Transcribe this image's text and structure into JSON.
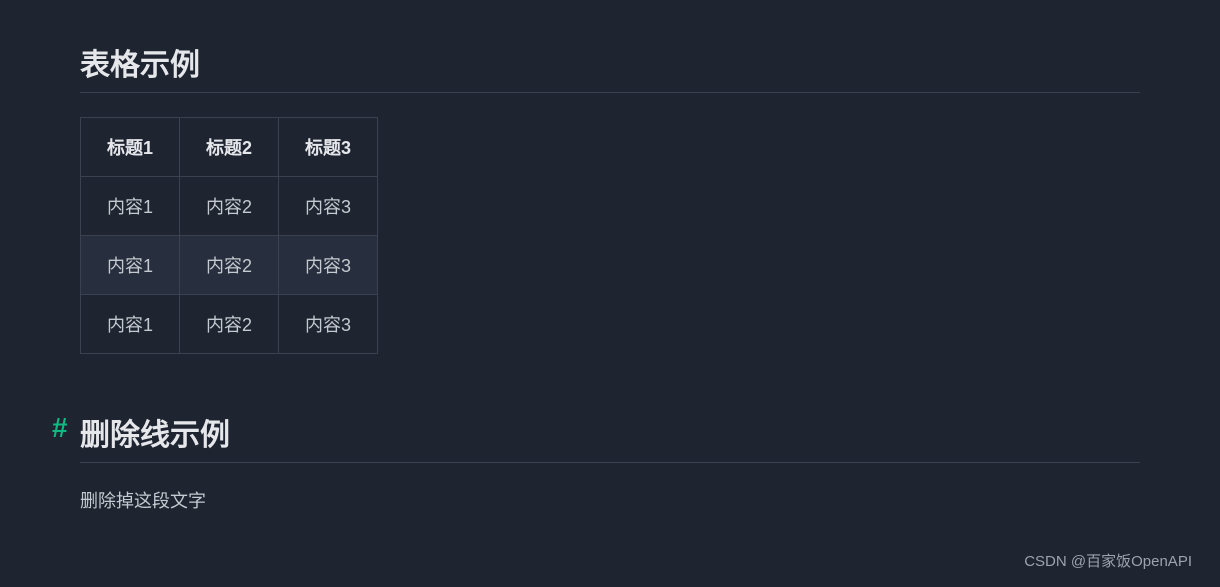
{
  "section_table": {
    "title": "表格示例",
    "headers": [
      "标题1",
      "标题2",
      "标题3"
    ],
    "rows": [
      [
        "内容1",
        "内容2",
        "内容3"
      ],
      [
        "内容1",
        "内容2",
        "内容3"
      ],
      [
        "内容1",
        "内容2",
        "内容3"
      ]
    ]
  },
  "section_strike": {
    "anchor": "#",
    "title": "删除线示例",
    "body": "删除掉这段文字"
  },
  "watermark": "CSDN @百家饭OpenAPI"
}
